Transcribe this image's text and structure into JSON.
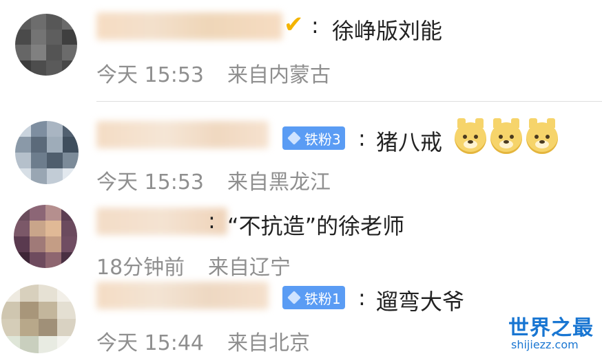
{
  "comments": [
    {
      "username_blurred": true,
      "verified_icon": "checkmark-v-icon",
      "badge": null,
      "separator": ":",
      "text": "徐峥版刘能",
      "time": "今天 15:53",
      "location": "来自内蒙古",
      "emojis": []
    },
    {
      "username_blurred": true,
      "badge": "铁粉3",
      "separator": ":",
      "text": "猪八戒",
      "time": "今天 15:53",
      "location": "来自黑龙江",
      "emojis": [
        "doge-emoji",
        "doge-emoji",
        "doge-emoji"
      ]
    },
    {
      "username_blurred": true,
      "badge": null,
      "separator": ":",
      "text": "“不抗造”的徐老师",
      "time": "18分钟前",
      "location": "来自辽宁",
      "emojis": []
    },
    {
      "username_blurred": true,
      "badge": "铁粉1",
      "separator": ":",
      "text": "遛弯大爷",
      "time": "今天 15:44",
      "location": "来自北京",
      "emojis": []
    }
  ],
  "watermark": {
    "logo_text": "世界之最",
    "url": "shijiezz.com"
  },
  "colors": {
    "badge_bg": "#5a9cf4",
    "meta_text": "#8f8f8f",
    "watermark": "#1976d2",
    "verified": "#f4b400"
  }
}
